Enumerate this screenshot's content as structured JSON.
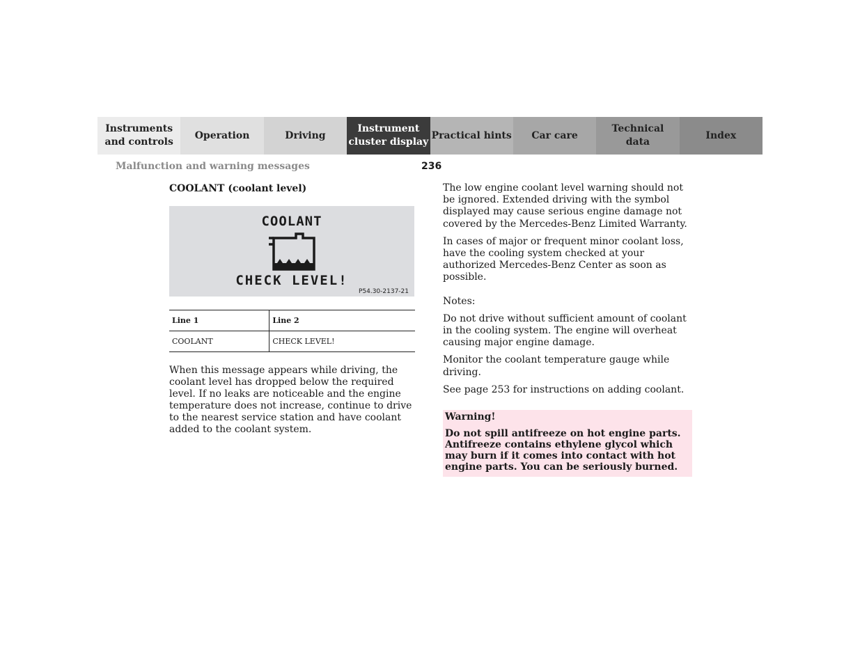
{
  "nav": {
    "tabs": [
      {
        "label_line1": "Instruments",
        "label_line2": "and controls",
        "bg": "#ececec",
        "active": false
      },
      {
        "label_line1": "Operation",
        "label_line2": "",
        "bg": "#e0e0e0",
        "active": false
      },
      {
        "label_line1": "Driving",
        "label_line2": "",
        "bg": "#d3d3d3",
        "active": false
      },
      {
        "label_line1": "Instrument",
        "label_line2": "cluster display",
        "bg": "#3b3b3b",
        "active": true
      },
      {
        "label_line1": "Practical hints",
        "label_line2": "",
        "bg": "#b5b5b5",
        "active": false
      },
      {
        "label_line1": "Car care",
        "label_line2": "",
        "bg": "#a7a7a7",
        "active": false
      },
      {
        "label_line1": "Technical",
        "label_line2": "data",
        "bg": "#999999",
        "active": false
      },
      {
        "label_line1": "Index",
        "label_line2": "",
        "bg": "#8b8b8b",
        "active": false
      }
    ]
  },
  "header": {
    "section_title": "Malfunction and warning messages",
    "page_number": "236"
  },
  "left": {
    "heading": "COOLANT (coolant level)",
    "display": {
      "line1": "COOLANT",
      "line2": "CHECK LEVEL!",
      "icon": "coolant-reservoir-icon",
      "figure_ref": "P54.30-2137-21"
    },
    "table": {
      "headers": [
        "Line 1",
        "Line 2"
      ],
      "rows": [
        [
          "COOLANT",
          "CHECK LEVEL!"
        ]
      ]
    },
    "paragraph": "When this message appears while driving, the coolant level has dropped below the required level. If no leaks are noticeable and the engine temperature does not increase, continue to drive to the nearest service station and have coolant added to the coolant system."
  },
  "right": {
    "paragraphs": [
      "The low engine coolant level warning should not be ignored. Extended driving with the symbol displayed may cause serious engine damage not covered by the Mercedes-Benz Limited Warranty.",
      "In cases of major or frequent minor coolant loss, have the cooling system checked at your authorized Mercedes-Benz Center as soon as possible."
    ],
    "notes_label": "Notes:",
    "notes": [
      "Do not drive without sufficient amount of coolant in the cooling system. The engine will overheat causing major engine damage.",
      "Monitor the coolant temperature gauge while driving.",
      "See page 253 for instructions on adding coolant."
    ],
    "warning": {
      "title": "Warning!",
      "text": "Do not spill antifreeze on hot engine parts. Antifreeze contains ethylene glycol which may burn if it comes into contact with hot engine parts. You can be seriously burned.",
      "bg": "#fde3ea"
    }
  }
}
